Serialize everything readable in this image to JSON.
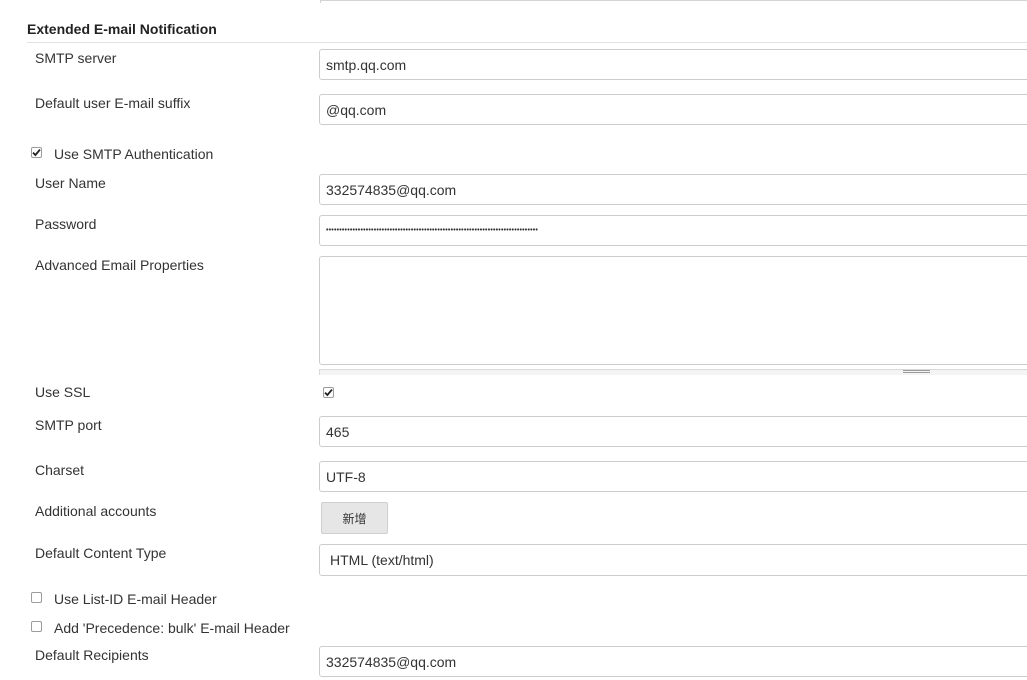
{
  "section": {
    "title": "Extended E-mail Notification"
  },
  "fields": {
    "smtp_server": {
      "label": "SMTP server",
      "value": "smtp.qq.com"
    },
    "email_suffix": {
      "label": "Default user E-mail suffix",
      "value": "@qq.com"
    },
    "use_smtp_auth": {
      "label": "Use SMTP Authentication",
      "checked": true
    },
    "user_name": {
      "label": "User Name",
      "value": "332574835@qq.com"
    },
    "password": {
      "label": "Password",
      "value": "••••••••••••••••••••••••••••••••••••••••••••••••••••••••••••••••••••••••••••••••"
    },
    "advanced_props": {
      "label": "Advanced Email Properties",
      "value": ""
    },
    "use_ssl": {
      "label": "Use SSL",
      "checked": true
    },
    "smtp_port": {
      "label": "SMTP port",
      "value": "465"
    },
    "charset": {
      "label": "Charset",
      "value": "UTF-8"
    },
    "additional_accounts": {
      "label": "Additional accounts",
      "button": "新增"
    },
    "content_type": {
      "label": "Default Content Type",
      "value": "HTML (text/html)"
    },
    "list_id_header": {
      "label": "Use List-ID E-mail Header",
      "checked": false
    },
    "precedence_header": {
      "label": "Add 'Precedence: bulk' E-mail Header",
      "checked": false
    },
    "default_recipients": {
      "label": "Default Recipients",
      "value": "332574835@qq.com"
    }
  }
}
